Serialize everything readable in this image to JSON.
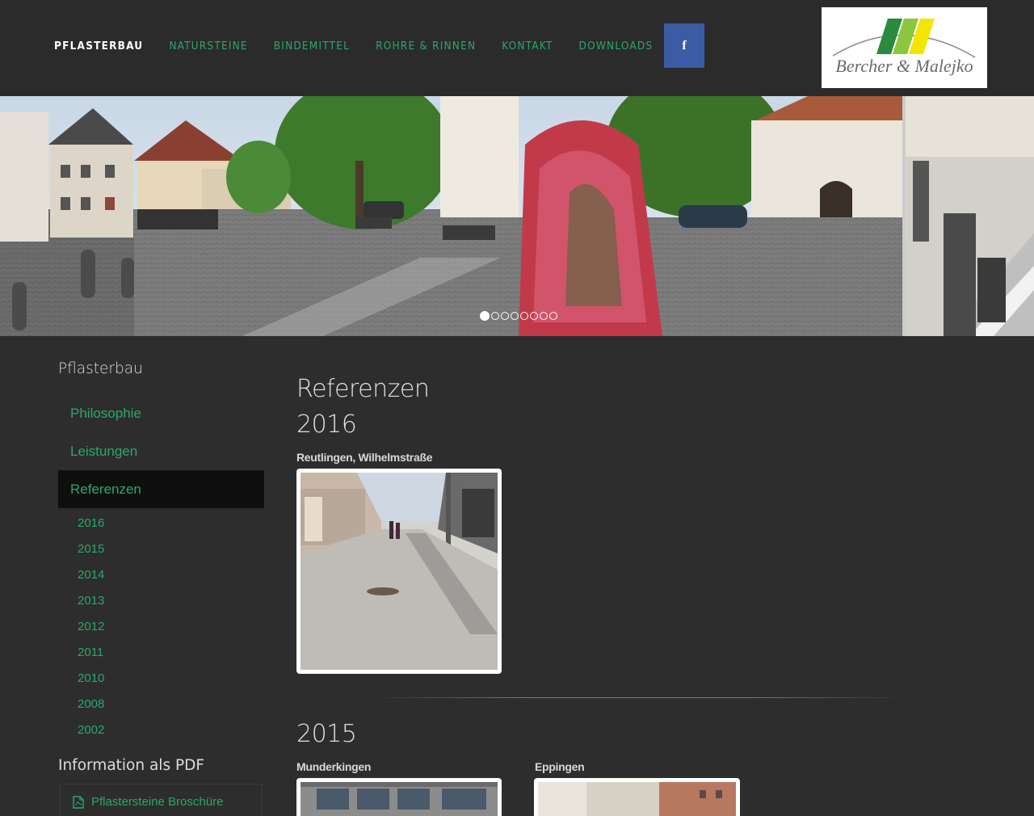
{
  "nav": {
    "items": [
      "PFLASTERBAU",
      "NATURSTEINE",
      "BINDEMITTEL",
      "ROHRE & RINNEN",
      "KONTAKT",
      "DOWNLOADS"
    ],
    "active_index": 0,
    "facebook_glyph": "f"
  },
  "logo": {
    "text": "Bercher & Malejko"
  },
  "slider": {
    "dot_count": 8,
    "active_dot": 0
  },
  "sidebar": {
    "title": "Pflasterbau",
    "items": [
      "Philosophie",
      "Leistungen",
      "Referenzen"
    ],
    "active_item": "Referenzen",
    "years": [
      "2016",
      "2015",
      "2014",
      "2013",
      "2012",
      "2011",
      "2010",
      "2008",
      "2002"
    ],
    "pdf_title": "Information als PDF",
    "pdf_link": "Pflastersteine Broschüre"
  },
  "main": {
    "title": "Referenzen",
    "sections": [
      {
        "year": "2016",
        "projects": [
          "Reutlingen, Wilhelmstraße"
        ]
      },
      {
        "year": "2015",
        "projects": [
          "Munderkingen",
          "Eppingen"
        ]
      }
    ]
  },
  "colors": {
    "accent": "#2aa86c",
    "background": "#2d2d2d",
    "header": "#2b2b2b",
    "facebook": "#3b5ba5"
  }
}
